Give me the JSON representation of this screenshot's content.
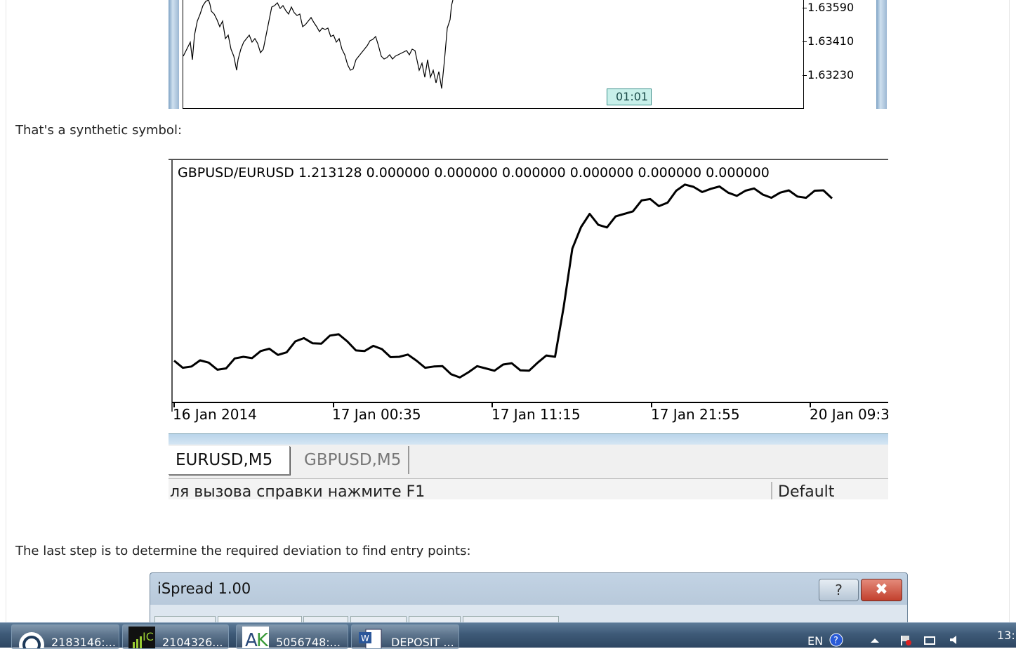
{
  "chart1": {
    "price_labels": [
      "1.63590",
      "1.63410",
      "1.63230"
    ],
    "time_badge": "01:01"
  },
  "captions": {
    "synthetic": "That's a synthetic symbol:",
    "last_step": "The last step is to determine the required deviation to find entry points:"
  },
  "chart2": {
    "legend": "GBPUSD/EURUSD 1.213128 0.000000 0.000000 0.000000 0.000000 0.000000 0.000000",
    "tabs": [
      {
        "label": "EURUSD,M5",
        "active": true
      },
      {
        "label": "GBPUSD,M5",
        "active": false
      }
    ],
    "status_text": "ля вызова справки нажмите F1",
    "status_profile": "Default"
  },
  "chart_data": {
    "type": "line",
    "title": "GBPUSD/EURUSD 1.213128 0.000000 0.000000 0.000000 0.000000 0.000000 0.000000",
    "x_tick_labels": [
      "16 Jan 2014",
      "17 Jan 00:35",
      "17 Jan 11:15",
      "17 Jan 21:55",
      "20 Jan 09:3"
    ],
    "y_relative_level": [
      0.1,
      0.07,
      0.09,
      0.06,
      0.12,
      0.15,
      0.13,
      0.2,
      0.19,
      0.23,
      0.2,
      0.15,
      0.16,
      0.12,
      0.1,
      0.07,
      0.03,
      0.04,
      0.06,
      0.08,
      0.05,
      0.09,
      0.12,
      0.68,
      0.86,
      0.79,
      0.86,
      0.93,
      0.9,
      0.98,
      1.0,
      0.99,
      0.97,
      0.98,
      0.96,
      0.97,
      0.95,
      0.98,
      0.94
    ]
  },
  "dialog": {
    "title": "iSpread 1.00",
    "help_label": "?",
    "close_label": "✖"
  },
  "taskbar": {
    "tasks": [
      {
        "label": "2183146:..."
      },
      {
        "label": "2104326..."
      },
      {
        "label": "5056748:..."
      },
      {
        "label": "DEPOSIT ..."
      }
    ],
    "lang": "EN",
    "clock": "13:"
  }
}
